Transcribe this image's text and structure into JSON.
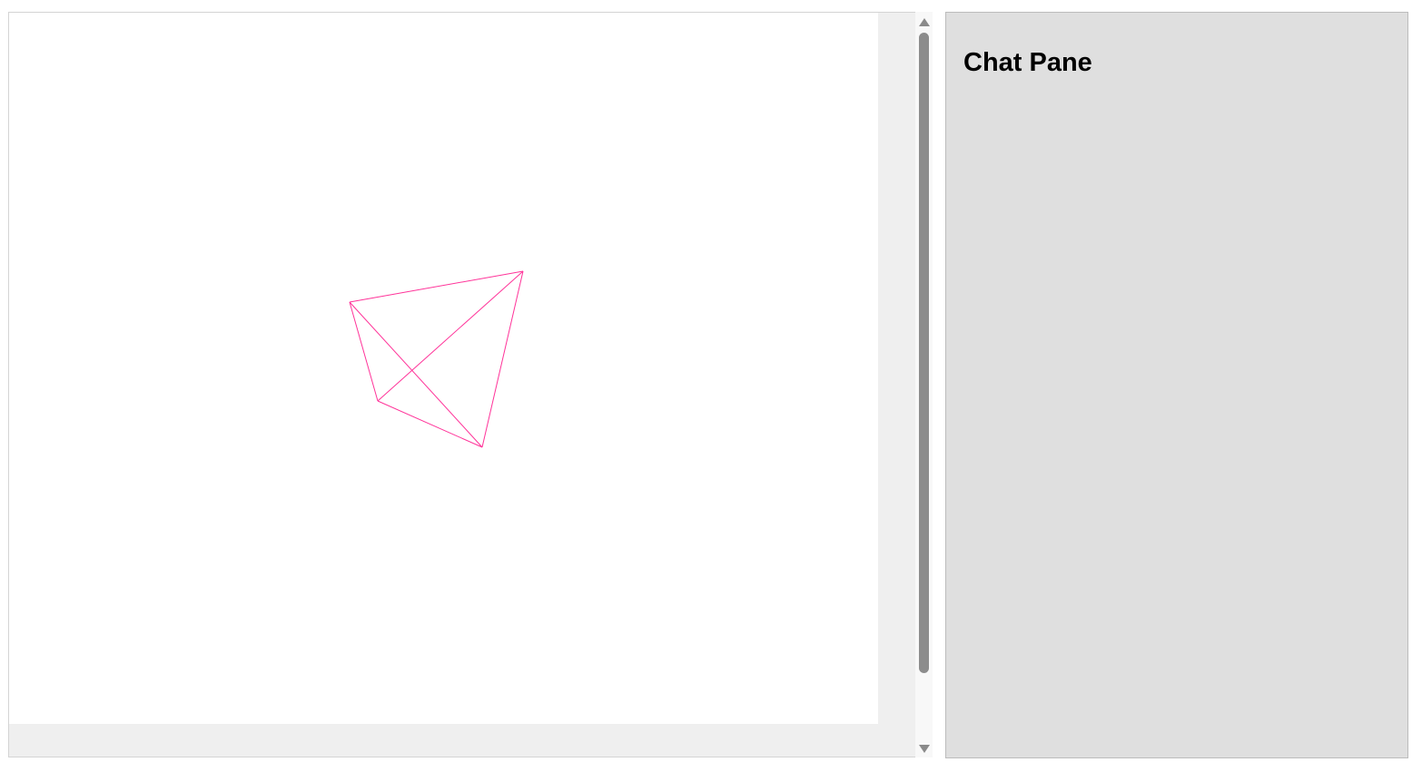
{
  "canvas": {
    "shape_color": "#ff3399",
    "shape": "tetrahedron-wireframe"
  },
  "scrollbar": {
    "up_icon": "triangle-up-icon",
    "down_icon": "triangle-down-icon"
  },
  "chat_pane": {
    "title": "Chat Pane"
  }
}
